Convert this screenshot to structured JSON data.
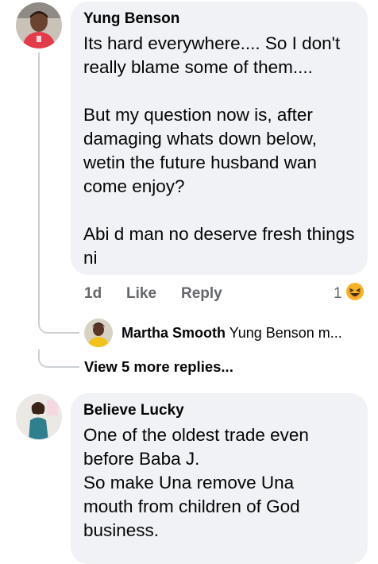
{
  "comment1": {
    "author": "Yung Benson",
    "text": "Its hard everywhere.... So I don't really blame some of them....\n\nBut my question now is, after damaging whats down below, wetin the future husband wan come enjoy?\n\nAbi d man no deserve fresh things ni",
    "time": "1d",
    "like_label": "Like",
    "reply_label": "Reply",
    "reaction_count": "1",
    "reaction_icon": "laugh-emoji-icon"
  },
  "reply_preview": {
    "author": "Martha Smooth",
    "text": "Yung Benson m..."
  },
  "view_more": {
    "label": "View 5 more replies..."
  },
  "comment2": {
    "author": "Believe Lucky",
    "text": "One of the oldest trade even before Baba J.\nSo make Una remove  Una mouth from children of God business."
  },
  "colors": {
    "bubble": "#f0f2f5",
    "meta": "#65676b",
    "thread": "#ccd0d5",
    "reaction_yellow": "#f7b125"
  }
}
